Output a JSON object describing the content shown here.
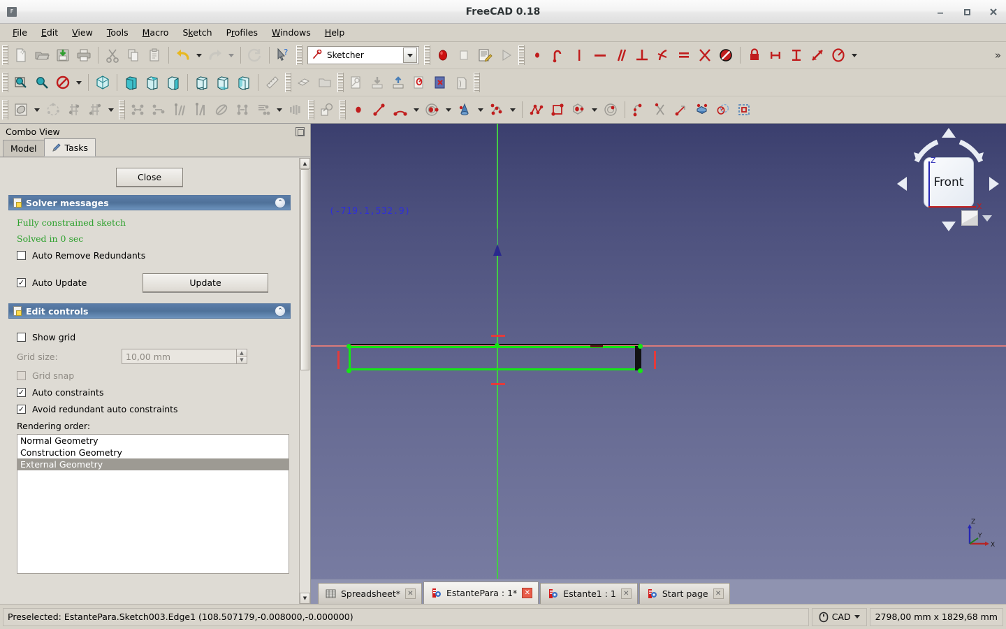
{
  "window": {
    "title": "FreeCAD 0.18",
    "app_icon": "freecad-icon",
    "minimize": "–",
    "maximize": "□",
    "close": "✕"
  },
  "menubar": {
    "items": [
      {
        "label": "File"
      },
      {
        "label": "Edit"
      },
      {
        "label": "View"
      },
      {
        "label": "Tools"
      },
      {
        "label": "Macro"
      },
      {
        "label": "Sketch"
      },
      {
        "label": "Profiles"
      },
      {
        "label": "Windows"
      },
      {
        "label": "Help"
      }
    ]
  },
  "toolbars": {
    "workbench_selector": {
      "value": "Sketcher",
      "icon": "sketcher-icon",
      "dropdown_icon": "chevron-down-icon"
    },
    "overflow_label": "»",
    "row1": [
      {
        "name": "new-document-icon"
      },
      {
        "name": "open-document-icon"
      },
      {
        "name": "save-document-icon"
      },
      {
        "name": "print-document-icon"
      },
      {
        "name": "cut-icon"
      },
      {
        "name": "copy-icon"
      },
      {
        "name": "paste-icon"
      },
      {
        "name": "undo-icon"
      },
      {
        "name": "redo-icon"
      },
      {
        "name": "refresh-icon"
      },
      {
        "name": "whats-this-icon"
      }
    ],
    "row1b": [
      {
        "name": "macro-record-icon"
      },
      {
        "name": "macro-stop-icon"
      },
      {
        "name": "macros-icon"
      },
      {
        "name": "macro-execute-icon"
      }
    ],
    "row1c": [
      {
        "name": "constrain-coincident-icon"
      },
      {
        "name": "constrain-point-on-object-icon"
      },
      {
        "name": "constrain-vertical-icon"
      },
      {
        "name": "constrain-horizontal-icon"
      },
      {
        "name": "constrain-parallel-icon"
      },
      {
        "name": "constrain-perpendicular-icon"
      },
      {
        "name": "constrain-tangent-icon"
      },
      {
        "name": "constrain-equal-icon"
      },
      {
        "name": "constrain-symmetric-icon"
      },
      {
        "name": "constrain-block-icon"
      },
      {
        "name": "constrain-lock-icon"
      },
      {
        "name": "constrain-distance-x-icon"
      },
      {
        "name": "constrain-distance-y-icon"
      },
      {
        "name": "constrain-distance-icon"
      },
      {
        "name": "constrain-angle-icon"
      }
    ],
    "row2": [
      {
        "name": "fit-all-icon"
      },
      {
        "name": "fit-selection-icon"
      },
      {
        "name": "draw-style-icon"
      },
      {
        "name": "isometric-view-icon"
      },
      {
        "name": "front-view-icon"
      },
      {
        "name": "top-view-icon"
      },
      {
        "name": "right-view-icon"
      },
      {
        "name": "rear-view-icon"
      },
      {
        "name": "bottom-view-icon"
      },
      {
        "name": "left-view-icon"
      },
      {
        "name": "measure-icon"
      },
      {
        "name": "workbench-part-icon"
      },
      {
        "name": "folder-icon"
      },
      {
        "name": "create-sketch-icon"
      },
      {
        "name": "import-icon"
      },
      {
        "name": "export-icon"
      },
      {
        "name": "edit-sketch-icon"
      },
      {
        "name": "leave-sketch-icon"
      },
      {
        "name": "view-section-icon"
      }
    ],
    "row3a": [
      {
        "name": "sketcher-visual-icon"
      },
      {
        "name": "sketcher-virtual-space-icon"
      },
      {
        "name": "sketcher-validate-icon"
      },
      {
        "name": "sketcher-mirror-icon"
      }
    ],
    "row3b": [
      {
        "name": "constrain-distance-tool-icon"
      },
      {
        "name": "constrain-horizontal-distance-icon"
      },
      {
        "name": "constrain-refraction-icon"
      },
      {
        "name": "constrain-internal-alignment-icon"
      },
      {
        "name": "constrain-toggle-driving-icon"
      },
      {
        "name": "constrain-snells-law-icon"
      },
      {
        "name": "constrain-toggle-active-icon"
      },
      {
        "name": "select-elements-icon"
      }
    ],
    "row3c": [
      {
        "name": "create-point-icon"
      },
      {
        "name": "create-line-icon"
      },
      {
        "name": "create-arc-icon"
      },
      {
        "name": "create-circle-icon"
      },
      {
        "name": "create-conic-icon"
      },
      {
        "name": "create-bspline-icon"
      },
      {
        "name": "create-polyline-icon"
      },
      {
        "name": "create-rectangle-icon"
      },
      {
        "name": "create-regular-polygon-icon"
      },
      {
        "name": "create-slot-icon"
      },
      {
        "name": "create-fillet-icon"
      },
      {
        "name": "trim-edge-icon"
      },
      {
        "name": "extend-edge-icon"
      },
      {
        "name": "external-geometry-icon"
      },
      {
        "name": "toggle-construction-icon"
      },
      {
        "name": "select-constraints-icon"
      }
    ]
  },
  "combo_view": {
    "title": "Combo View",
    "float_icon": "undock-icon",
    "tabs": [
      {
        "label": "Model",
        "icon": "model-icon",
        "active": false
      },
      {
        "label": "Tasks",
        "icon": "pencil-icon",
        "active": true
      }
    ],
    "close_button": "Close",
    "solver": {
      "title": "Solver messages",
      "icon": "note-icon",
      "collapse_icon": "chevron-up-icon",
      "status_line1": "Fully constrained sketch",
      "status_line2": "Solved in 0 sec",
      "auto_remove_redundants": {
        "label": "Auto Remove Redundants",
        "checked": false
      },
      "auto_update": {
        "label": "Auto Update",
        "checked": true
      },
      "update_button": "Update"
    },
    "edit_controls": {
      "title": "Edit controls",
      "icon": "note-icon",
      "collapse_icon": "chevron-up-icon",
      "show_grid": {
        "label": "Show grid",
        "checked": false
      },
      "grid_size": {
        "label": "Grid size:",
        "value": "10,00 mm",
        "disabled": true
      },
      "grid_snap": {
        "label": "Grid snap",
        "checked": false,
        "disabled": true
      },
      "auto_constraints": {
        "label": "Auto constraints",
        "checked": true
      },
      "avoid_redundant": {
        "label": "Avoid redundant auto constraints",
        "checked": true
      },
      "rendering_order_label": "Rendering order:",
      "rendering_order": [
        {
          "label": "Normal Geometry",
          "selected": false
        },
        {
          "label": "Construction Geometry",
          "selected": false
        },
        {
          "label": "External Geometry",
          "selected": true
        }
      ]
    },
    "scrollbar": {
      "up_icon": "scroll-up-icon",
      "down_icon": "scroll-down-icon"
    }
  },
  "viewport": {
    "coordinate_readout": "(-719.1,532.9)",
    "colors": {
      "background_top": "#3b3f6e",
      "background_bottom": "#7a7ea3",
      "geometry_green": "#15e615",
      "constraint_red": "#e33b3b",
      "axis_x_red": "#d97b7b",
      "axis_y_green": "#44cc44",
      "external_geometry_black": "#121212",
      "coord_text_blue": "#2f2fd8"
    },
    "nav_cube": {
      "face_label": "Front",
      "axis_z_label": "Z",
      "axis_x_label": "X",
      "up_arrow": "nav-up-arrow-icon",
      "down_arrow": "nav-down-arrow-icon",
      "left_arrow": "nav-left-arrow-icon",
      "right_arrow": "nav-right-arrow-icon",
      "corner_cube": "nav-corner-cube-icon"
    },
    "axis_indicator": {
      "x": "X",
      "y": "Y",
      "z": "Z"
    }
  },
  "document_tabs": [
    {
      "label": "Spreadsheet*",
      "icon": "spreadsheet-icon",
      "active": false,
      "close_icon": "close-icon"
    },
    {
      "label": "EstantePara : 1*",
      "icon": "freecad-doc-icon",
      "active": true,
      "close_icon": "close-icon"
    },
    {
      "label": "Estante1 : 1",
      "icon": "freecad-doc-icon",
      "active": false,
      "close_icon": "close-icon"
    },
    {
      "label": "Start page",
      "icon": "freecad-doc-icon",
      "active": false,
      "close_icon": "close-icon"
    }
  ],
  "statusbar": {
    "message": "Preselected: EstantePara.Sketch003.Edge1 (108.507179,-0.008000,-0.000000)",
    "nav_mode": {
      "label": "CAD",
      "icon": "mouse-icon",
      "dropdown_icon": "chevron-down-icon"
    },
    "dimensions": "2798,00 mm x 1829,68 mm"
  }
}
